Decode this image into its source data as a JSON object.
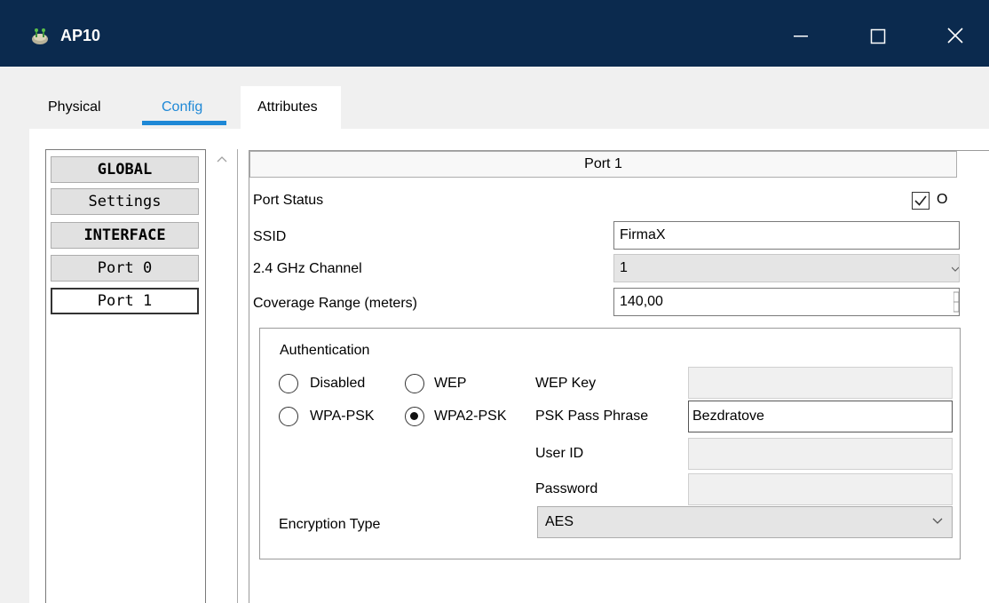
{
  "window": {
    "title": "AP10"
  },
  "tabs": [
    {
      "label": "Physical"
    },
    {
      "label": "Config"
    },
    {
      "label": "Attributes"
    }
  ],
  "left_nav": {
    "items": [
      {
        "label": "GLOBAL",
        "kind": "header"
      },
      {
        "label": "Settings",
        "kind": "item"
      },
      {
        "label": "INTERFACE",
        "kind": "header"
      },
      {
        "label": "Port 0",
        "kind": "item"
      },
      {
        "label": "Port 1",
        "kind": "item",
        "selected": true
      }
    ]
  },
  "port": {
    "title": "Port 1",
    "status_label": "Port Status",
    "status_checked": true,
    "status_check_label": "O",
    "ssid_label": "SSID",
    "ssid_value": "FirmaX",
    "channel_label": "2.4 GHz Channel",
    "channel_value": "1",
    "coverage_label": "Coverage Range (meters)",
    "coverage_value": "140,00"
  },
  "auth": {
    "title": "Authentication",
    "options": {
      "disabled": "Disabled",
      "wep": "WEP",
      "wpa_psk": "WPA-PSK",
      "wpa2_psk": "WPA2-PSK"
    },
    "selected": "wpa2_psk",
    "wep_key_label": "WEP Key",
    "wep_key_value": "",
    "psk_label": "PSK Pass Phrase",
    "psk_value": "Bezdratove",
    "user_id_label": "User ID",
    "user_id_value": "",
    "password_label": "Password",
    "password_value": "",
    "encryption_label": "Encryption Type",
    "encryption_value": "AES"
  },
  "colors": {
    "titlebar": "#0b2a4e",
    "tab_accent": "#1e88d6"
  }
}
